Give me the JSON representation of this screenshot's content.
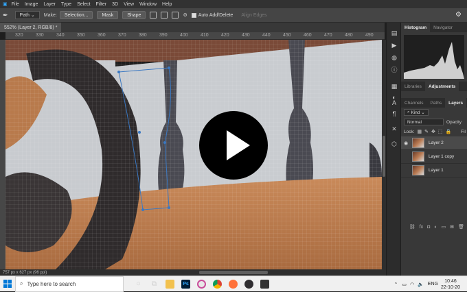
{
  "menu": [
    "File",
    "Image",
    "Layer",
    "Type",
    "Select",
    "Filter",
    "3D",
    "View",
    "Window",
    "Help"
  ],
  "options": {
    "mode": "Path",
    "make_label": "Make:",
    "selection_btn": "Selection...",
    "mask_btn": "Mask",
    "shape_btn": "Shape",
    "auto_add_delete": "Auto Add/Delete",
    "align_edges": "Align Edges"
  },
  "doc_tab": "552% (Layer 2, RGB/8) *",
  "ruler": [
    "320",
    "330",
    "340",
    "350",
    "360",
    "370",
    "380",
    "390",
    "400",
    "410",
    "420",
    "430",
    "440",
    "450",
    "460",
    "470",
    "480",
    "490"
  ],
  "status": "757 px x 627 px (96 ppi)",
  "panel": {
    "top_tabs": [
      "Histogram",
      "Navigator"
    ],
    "mid_tabs": [
      "Libraries",
      "Adjustments"
    ],
    "layer_tabs": [
      "Channels",
      "Paths",
      "Layers"
    ],
    "kind_label": "Kind",
    "blend_mode": "Normal",
    "opacity_label": "Opacity",
    "lock_label": "Lock:",
    "fill_label": "Fil",
    "layers": [
      {
        "name": "Layer 2",
        "selected": true,
        "visible": true
      },
      {
        "name": "Layer 1 copy",
        "selected": false,
        "visible": false
      },
      {
        "name": "Layer 1",
        "selected": false,
        "visible": false
      }
    ]
  },
  "taskbar": {
    "search_placeholder": "Type here to search",
    "lang": "ENG",
    "time": "10:46",
    "date": "22-10-20",
    "ps_label": "Ps"
  },
  "colors": {
    "ps_blue": "#001e36",
    "accent_blue": "#31a8ff"
  }
}
